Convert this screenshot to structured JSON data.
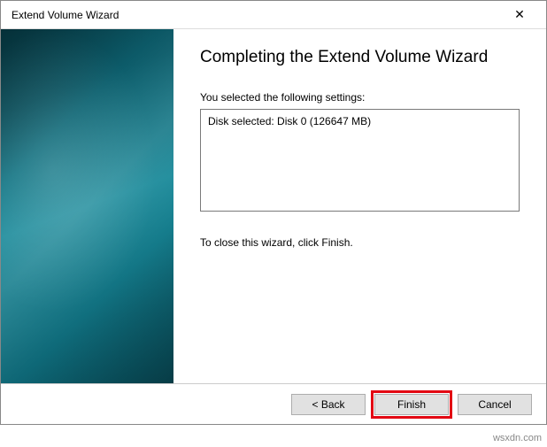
{
  "window": {
    "title": "Extend Volume Wizard",
    "close_glyph": "✕"
  },
  "content": {
    "heading": "Completing the Extend Volume Wizard",
    "settings_label": "You selected the following settings:",
    "settings_text": "Disk selected: Disk 0 (126647 MB)",
    "close_note": "To close this wizard, click Finish."
  },
  "buttons": {
    "back": "< Back",
    "finish": "Finish",
    "cancel": "Cancel"
  },
  "watermark": "wsxdn.com"
}
